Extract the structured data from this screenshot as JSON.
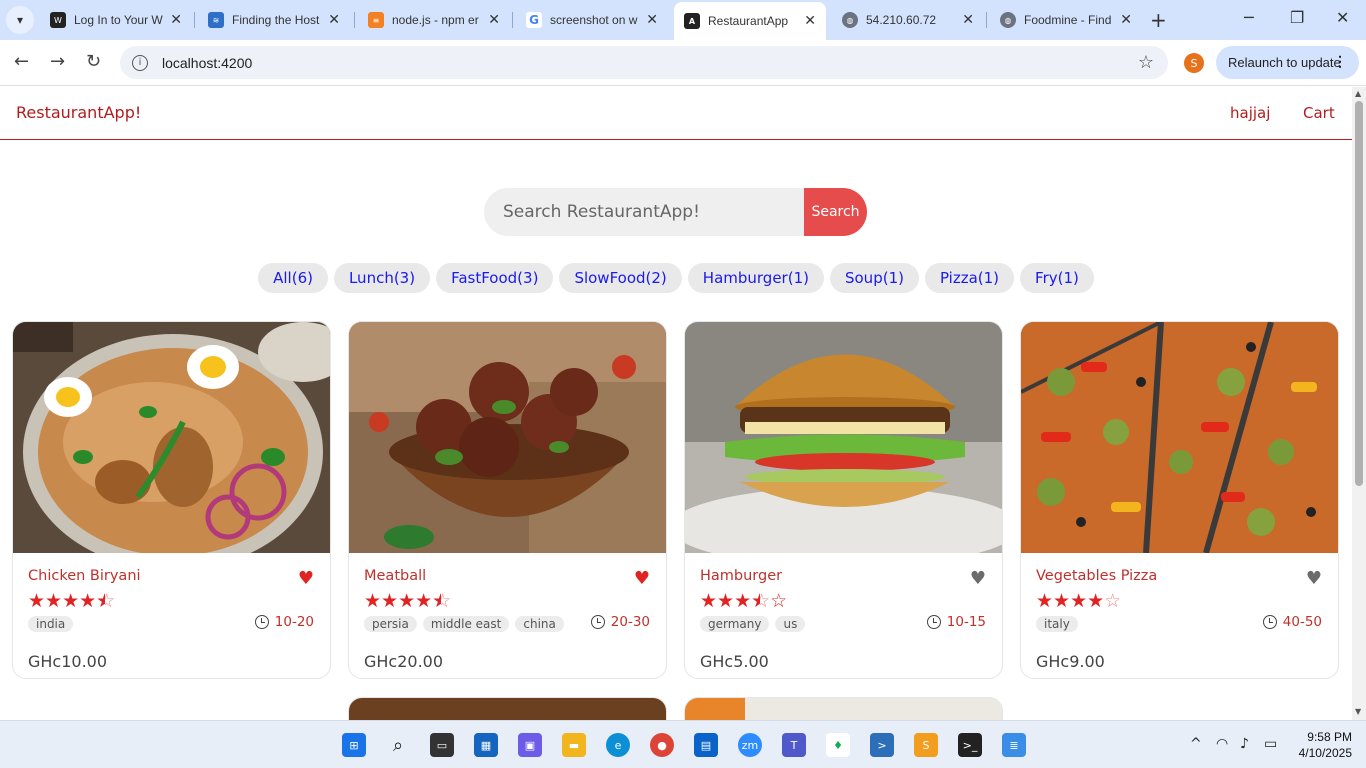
{
  "browser": {
    "tabs": [
      {
        "title": "Log In to Your W",
        "icon": "wix-icon"
      },
      {
        "title": "Finding the Host",
        "icon": "hosting-icon"
      },
      {
        "title": "node.js - npm er",
        "icon": "stackoverflow-icon"
      },
      {
        "title": "screenshot on w",
        "icon": "google-icon"
      },
      {
        "title": "RestaurantApp",
        "icon": "angular-icon"
      },
      {
        "title": "54.210.60.72",
        "icon": "globe-icon"
      },
      {
        "title": "Foodmine - Find",
        "icon": "globe-icon"
      }
    ],
    "active_tab_index": 4,
    "url": "localhost:4200",
    "profile_initial": "S",
    "relaunch_label": "Relaunch to update"
  },
  "app": {
    "brand": "RestaurantApp!",
    "nav": {
      "user": "hajjaj",
      "cart": "Cart"
    },
    "search": {
      "placeholder": "Search RestaurantApp!",
      "button": "Search"
    },
    "tags": [
      "All(6)",
      "Lunch(3)",
      "FastFood(3)",
      "SlowFood(2)",
      "Hamburger(1)",
      "Soup(1)",
      "Pizza(1)",
      "Fry(1)"
    ],
    "foods": [
      {
        "name": "Chicken Biryani",
        "favorite": true,
        "stars": 4.5,
        "origins": [
          "india"
        ],
        "cook_time": "10-20",
        "price": "GHc10.00"
      },
      {
        "name": "Meatball",
        "favorite": true,
        "stars": 4.5,
        "origins": [
          "persia",
          "middle east",
          "china"
        ],
        "cook_time": "20-30",
        "price": "GHc20.00"
      },
      {
        "name": "Hamburger",
        "favorite": false,
        "stars": 3.5,
        "origins": [
          "germany",
          "us"
        ],
        "cook_time": "10-15",
        "price": "GHc5.00"
      },
      {
        "name": "Vegetables Pizza",
        "favorite": false,
        "stars": 4,
        "origins": [
          "italy"
        ],
        "cook_time": "40-50",
        "price": "GHc9.00"
      }
    ]
  },
  "taskbar": {
    "time": "9:58 PM",
    "date": "4/10/2025"
  },
  "colors": {
    "brand": "#b21c1c",
    "search_button": "#e74c4c",
    "tag_text": "#1a1aee",
    "star": "#e02424",
    "fav_on": "#e02424",
    "fav_off": "#6b6b6b"
  }
}
